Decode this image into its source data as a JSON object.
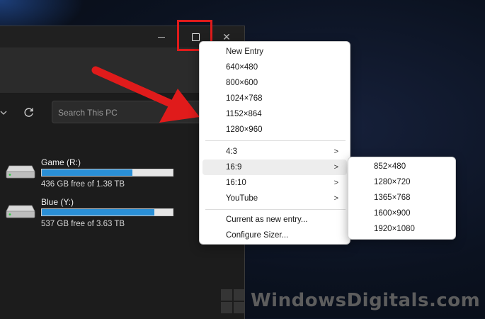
{
  "colors": {
    "highlight": "#e01b1b",
    "arrow": "#e01b1b",
    "drive_fill": "#2a8fd6",
    "menu_bg": "#ffffff",
    "explorer_bg": "#1c1c1c"
  },
  "explorer": {
    "search_placeholder": "Search This PC",
    "drives": [
      {
        "name": "Game (R:)",
        "free": "436 GB free of 1.38 TB",
        "used_fraction": 0.69
      },
      {
        "name": "Blue (Y:)",
        "free": "537 GB free of 3.63 TB",
        "used_fraction": 0.86
      }
    ]
  },
  "sizer_menu": {
    "items": [
      {
        "label": "New Entry"
      },
      {
        "label": "640×480"
      },
      {
        "label": "800×600"
      },
      {
        "label": "1024×768"
      },
      {
        "label": "1152×864"
      },
      {
        "label": "1280×960"
      }
    ],
    "groups": [
      {
        "label": "4:3"
      },
      {
        "label": "16:9"
      },
      {
        "label": "16:10"
      },
      {
        "label": "YouTube"
      }
    ],
    "actions": [
      {
        "label": "Current as new entry..."
      },
      {
        "label": "Configure Sizer..."
      }
    ],
    "submenu_16_9": [
      {
        "label": "852×480"
      },
      {
        "label": "1280×720"
      },
      {
        "label": "1365×768"
      },
      {
        "label": "1600×900"
      },
      {
        "label": "1920×1080"
      }
    ]
  },
  "watermark": {
    "text": "WindowsDigitals.com"
  }
}
